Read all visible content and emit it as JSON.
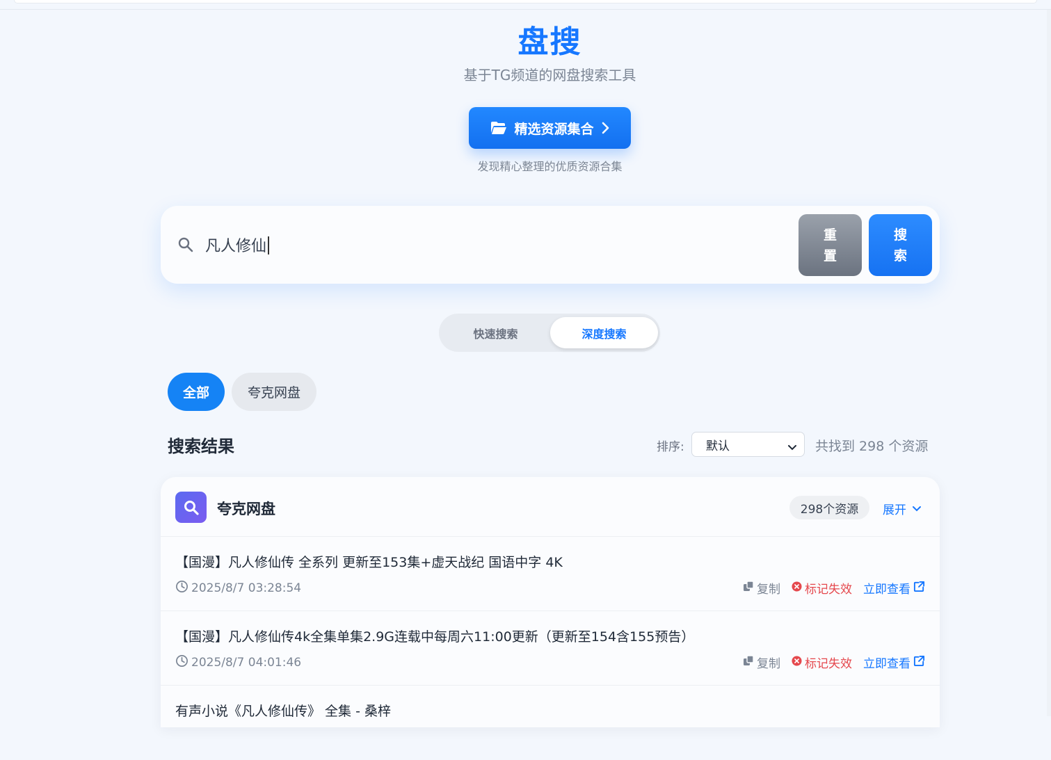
{
  "app": {
    "title": "盘搜",
    "subtitle": "基于TG频道的网盘搜索工具",
    "featured_button": "精选资源集合",
    "featured_desc": "发现精心整理的优质资源合集"
  },
  "search": {
    "value": "凡人修仙",
    "reset_label_1": "重",
    "reset_label_2": "置",
    "search_label_1": "搜",
    "search_label_2": "索"
  },
  "modes": {
    "fast": "快速搜索",
    "deep": "深度搜索",
    "active": "深度搜索"
  },
  "filters": {
    "all": "全部",
    "quark": "夸克网盘",
    "active": "全部"
  },
  "results": {
    "title": "搜索结果",
    "sort_label": "排序:",
    "sort_value": "默认",
    "count_text": "共找到 298 个资源"
  },
  "group": {
    "name": "夸克网盘",
    "badge": "298个资源",
    "expand": "展开",
    "items": [
      {
        "title": "【国漫】凡人修仙传 全系列 更新至153集+虚天战纪 国语中字 4K",
        "time": "2025/8/7 03:28:54",
        "copy": "复制",
        "invalid": "标记失效",
        "view": "立即查看"
      },
      {
        "title": "【国漫】凡人修仙传4k全集单集2.9G连载中每周六11:00更新（更新至154含155预告）",
        "time": "2025/8/7 04:01:46",
        "copy": "复制",
        "invalid": "标记失效",
        "view": "立即查看"
      },
      {
        "title": "有声小说《凡人修仙传》 全集 - 桑梓"
      }
    ]
  },
  "colors": {
    "accent": "#1677ff",
    "danger": "#e5484d",
    "background": "#f3f7fd"
  }
}
